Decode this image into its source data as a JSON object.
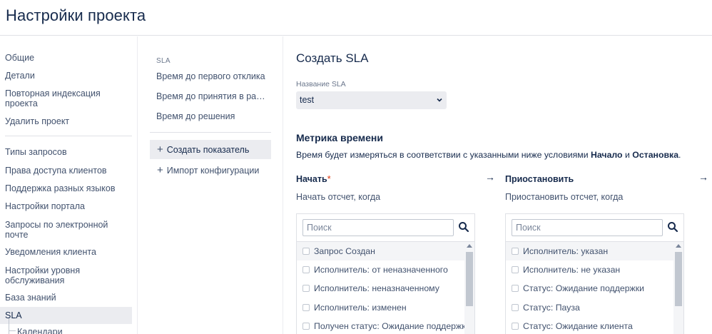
{
  "header": {
    "title": "Настройки проекта"
  },
  "sidebar": {
    "items": [
      "Общие",
      "Детали",
      "Повторная индексация проекта",
      "Удалить проект",
      "Типы запросов",
      "Права доступа клиентов",
      "Поддержка разных языков",
      "Настройки портала",
      "Запросы по электронной почте",
      "Уведомления клиента",
      "Настройки уровня обслуживания",
      "База знаний",
      "SLA"
    ],
    "sub_item": "Календари"
  },
  "middle": {
    "heading": "SLA",
    "items": [
      "Время до первого отклика",
      "Время до принятия в работу",
      "Время до решения"
    ],
    "create_label": "Создать показатель",
    "import_label": "Импорт конфигурации"
  },
  "main": {
    "title": "Создать SLA",
    "name_label": "Название SLA",
    "name_value": "test",
    "metric_title": "Метрика времени",
    "metric_desc_pre": "Время будет измеряться в соответствии с указанными ниже условиями ",
    "metric_desc_start": "Начало",
    "metric_desc_and": " и ",
    "metric_desc_stop": "Остановка",
    "metric_desc_end": ".",
    "start": {
      "title": "Начать",
      "required_mark": "*",
      "subtitle": "Начать отсчет, когда",
      "search_placeholder": "Поиск",
      "options": [
        "Запрос Создан",
        "Исполнитель: от неназначенного",
        "Исполнитель: неназначенному",
        "Исполнитель: изменен",
        "Получен статус: Ожидание поддержки"
      ]
    },
    "pause": {
      "title": "Приостановить",
      "subtitle": "Приостановить отсчет, когда",
      "search_placeholder": "Поиск",
      "options": [
        "Исполнитель: указан",
        "Исполнитель: не указан",
        "Статус: Ожидание поддержки",
        "Статус: Пауза",
        "Статус: Ожидание клиента"
      ]
    },
    "arrow": "→"
  },
  "colors": {
    "text": "#172b4d",
    "muted": "#42526e",
    "required": "#de350b",
    "active_bg": "#ebecf0"
  }
}
